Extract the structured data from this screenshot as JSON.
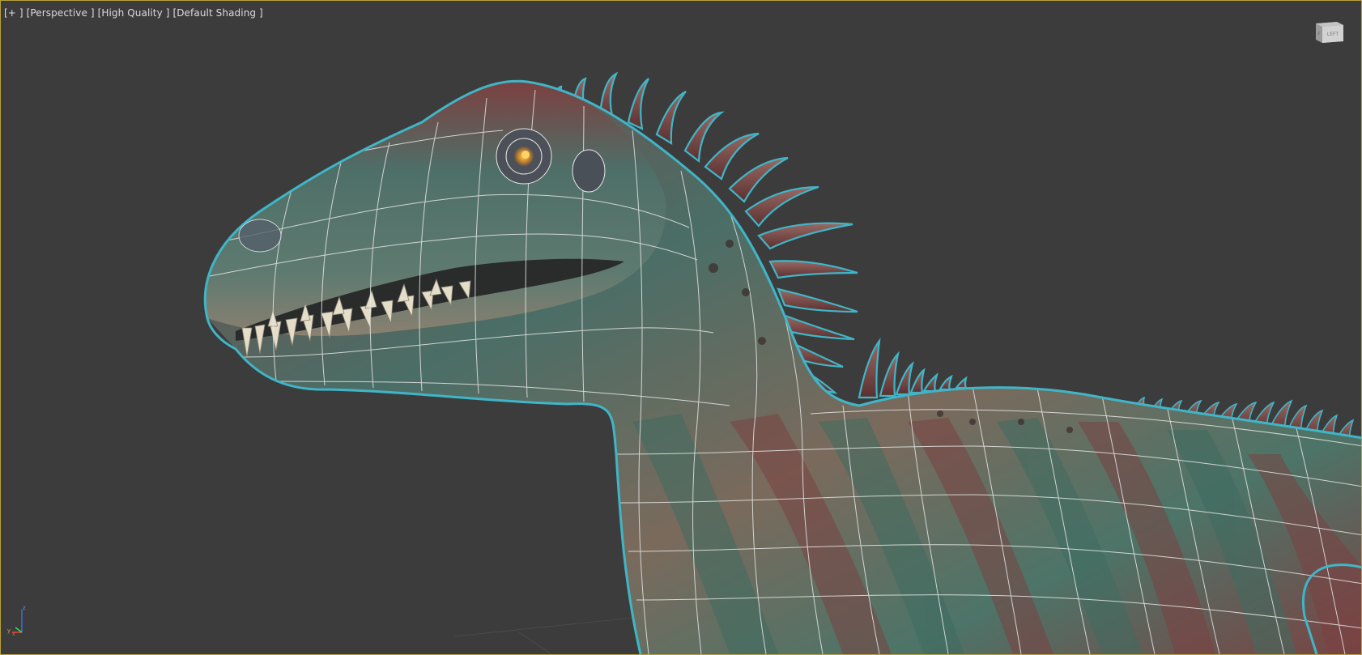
{
  "viewport": {
    "label_plus": "[+ ]",
    "label_view": "[Perspective ]",
    "label_quality": "[High Quality ]",
    "label_shading": "[Default Shading ]",
    "border_color": "#b9a13a",
    "background_color": "#3c3c3c"
  },
  "viewcube": {
    "icon": "viewcube-icon",
    "face_label": "LEFT",
    "face_label_side": "F"
  },
  "axis_tripod": {
    "icon": "axis-tripod-icon",
    "x_label": "x",
    "y_label": "y",
    "z_label": "z"
  },
  "model": {
    "icon": "dinosaur-model",
    "selection_outline_color": "#3fb6c8",
    "wireframe_color": "#e8e8e8",
    "skin_colors": [
      "#7a4040",
      "#456d64",
      "#8a7a6a"
    ]
  }
}
